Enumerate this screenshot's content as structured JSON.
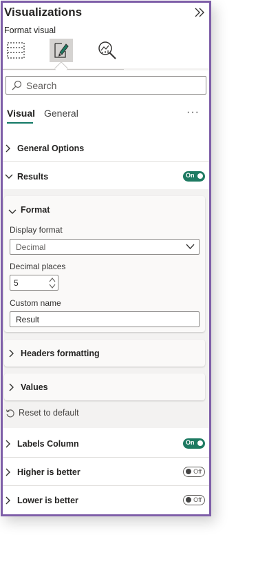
{
  "pane": {
    "title": "Visualizations",
    "subtitle": "Format visual"
  },
  "search": {
    "placeholder": "Search"
  },
  "tabs": {
    "visual": "Visual",
    "general": "General",
    "more": "···"
  },
  "sections": {
    "general_options": "General Options",
    "results": "Results",
    "labels_column": "Labels Column",
    "higher_is_better": "Higher is better",
    "lower_is_better": "Lower is better"
  },
  "toggles": {
    "results": "On",
    "labels_column": "On",
    "higher_is_better": "Off",
    "lower_is_better": "Off"
  },
  "format_card": {
    "title": "Format",
    "display_format_label": "Display format",
    "display_format_value": "Decimal",
    "decimal_places_label": "Decimal places",
    "decimal_places_value": "5",
    "custom_name_label": "Custom name",
    "custom_name_value": "Result"
  },
  "cards": {
    "headers_formatting": "Headers formatting",
    "values": "Values"
  },
  "reset": "Reset to default",
  "colors": {
    "accent": "#117865",
    "toggle_on": "#1e7a62",
    "border": "#7e5ea8"
  }
}
